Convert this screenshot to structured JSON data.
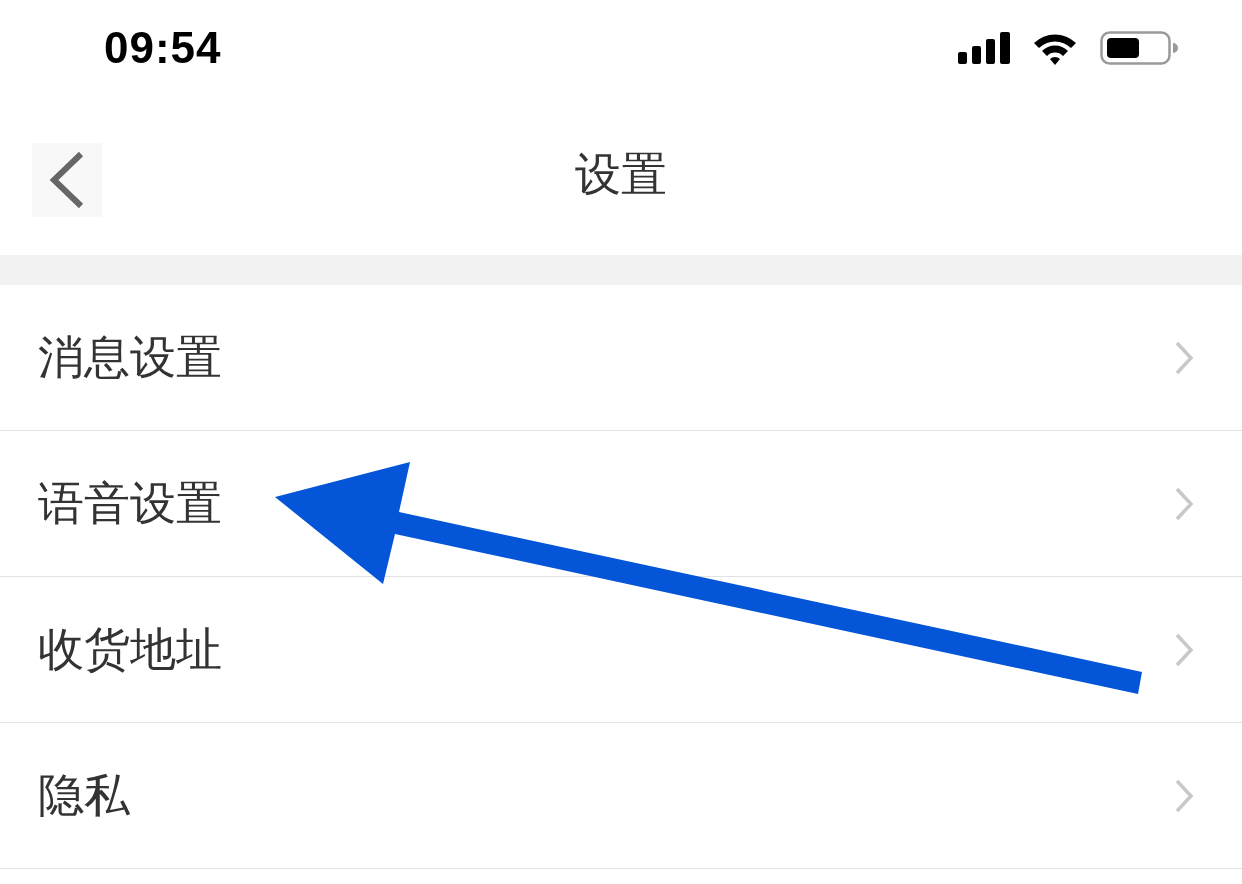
{
  "status_bar": {
    "time": "09:54"
  },
  "nav_bar": {
    "title": "设置"
  },
  "settings_list": [
    {
      "label": "消息设置"
    },
    {
      "label": "语音设置"
    },
    {
      "label": "收货地址"
    },
    {
      "label": "隐私"
    }
  ]
}
